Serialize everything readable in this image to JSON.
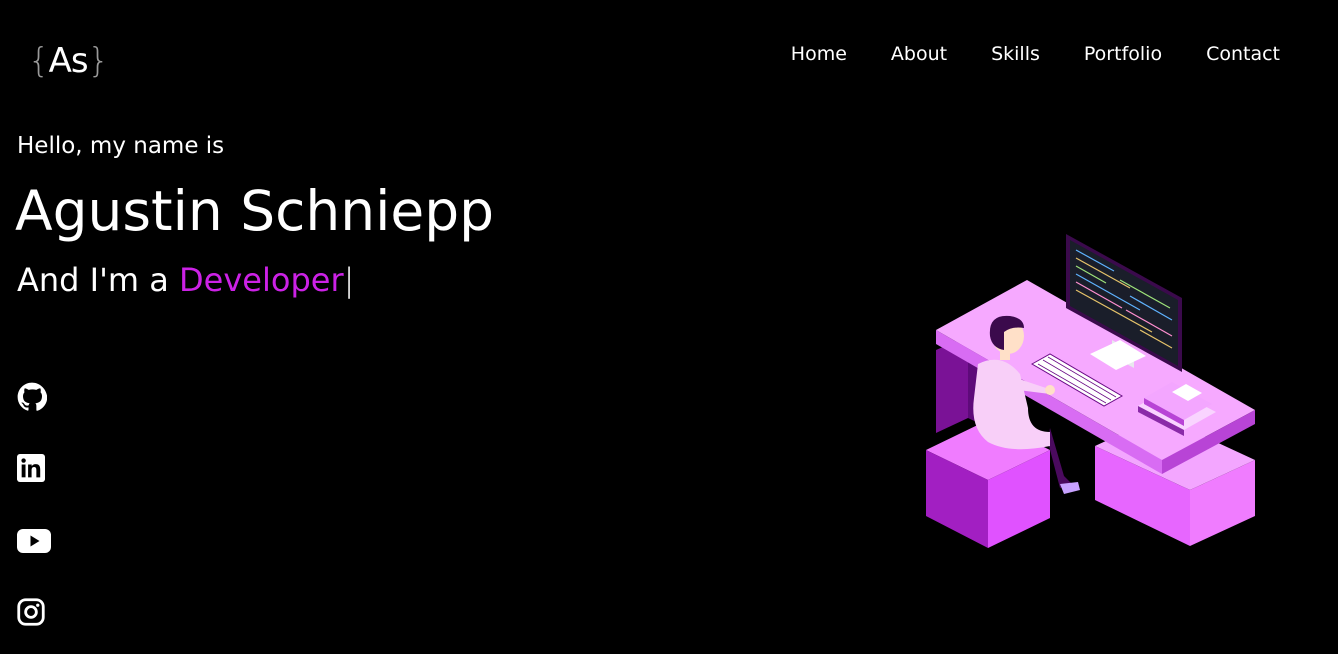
{
  "logo": {
    "open": "{",
    "text": "As",
    "close": "}"
  },
  "nav": {
    "items": [
      {
        "label": "Home"
      },
      {
        "label": "About"
      },
      {
        "label": "Skills"
      },
      {
        "label": "Portfolio"
      },
      {
        "label": "Contact"
      }
    ]
  },
  "hero": {
    "greeting": "Hello, my name is",
    "name": "Agustin Schniepp",
    "role_prefix": "And I'm a ",
    "role_highlight": "Developer",
    "cursor": "|"
  },
  "socials": [
    {
      "icon": "github-icon"
    },
    {
      "icon": "linkedin-icon"
    },
    {
      "icon": "youtube-icon"
    },
    {
      "icon": "instagram-icon"
    }
  ],
  "colors": {
    "background": "#000000",
    "text": "#ffffff",
    "accent": "#cc22e6",
    "illustration_light": "#f3a6ff",
    "illustration_mid": "#d35cf0",
    "illustration_dark": "#6a0a86"
  }
}
